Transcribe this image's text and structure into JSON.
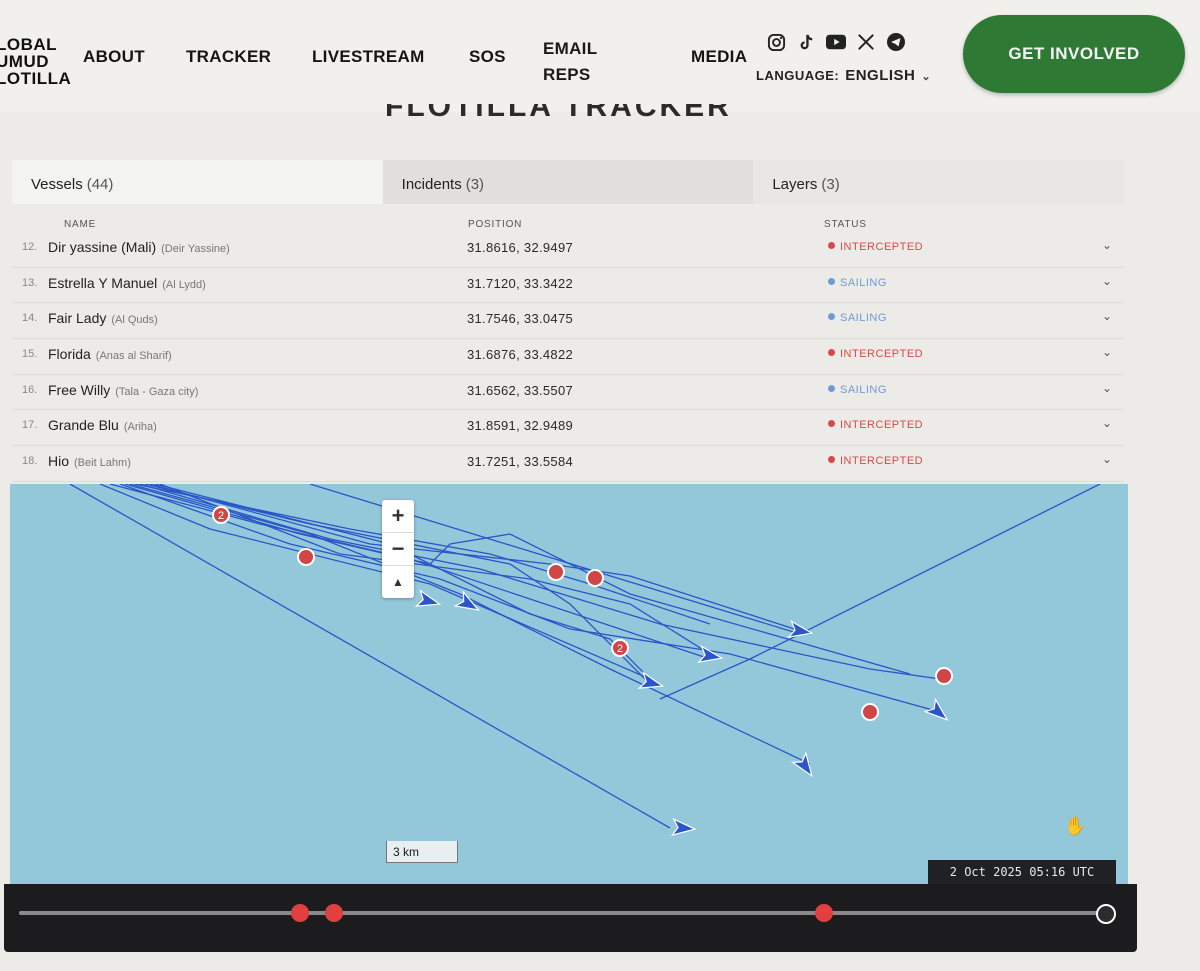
{
  "header": {
    "logo_lines": [
      "LOBAL",
      "UMUD",
      "LOTILLA"
    ],
    "nav": {
      "about": "ABOUT",
      "tracker": "TRACKER",
      "livestream": "LIVESTREAM",
      "sos": "SOS",
      "email_line1": "EMAIL",
      "email_line2": "REPS",
      "media": "MEDIA"
    },
    "social_icons": [
      "instagram-icon",
      "tiktok-icon",
      "youtube-icon",
      "x-icon",
      "telegram-icon"
    ],
    "language_label": "LANGUAGE:",
    "language_value": "ENGLISH",
    "cta_label": "GET INVOLVED",
    "page_heading": "FLOTILLA TRACKER"
  },
  "tabs": [
    {
      "label": "Vessels",
      "count": "(44)"
    },
    {
      "label": "Incidents",
      "count": "(3)"
    },
    {
      "label": "Layers",
      "count": "(3)"
    }
  ],
  "table": {
    "columns": {
      "name": "NAME",
      "position": "POSITION",
      "status": "STATUS"
    },
    "rows": [
      {
        "num": "12.",
        "name": "Dir yassine (Mali)",
        "sub": "(Deir Yassine)",
        "position": "31.8616, 32.9497",
        "status": "INTERCEPTED"
      },
      {
        "num": "13.",
        "name": "Estrella Y Manuel",
        "sub": "(Al Lydd)",
        "position": "31.7120, 33.3422",
        "status": "SAILING"
      },
      {
        "num": "14.",
        "name": "Fair Lady",
        "sub": "(Al Quds)",
        "position": "31.7546, 33.0475",
        "status": "SAILING"
      },
      {
        "num": "15.",
        "name": "Florida",
        "sub": "(Anas al Sharif)",
        "position": "31.6876, 33.4822",
        "status": "INTERCEPTED"
      },
      {
        "num": "16.",
        "name": "Free Willy",
        "sub": "(Tala - Gaza city)",
        "position": "31.6562, 33.5507",
        "status": "SAILING"
      },
      {
        "num": "17.",
        "name": "Grande Blu",
        "sub": "(Ariha)",
        "position": "31.8591, 32.9489",
        "status": "INTERCEPTED"
      },
      {
        "num": "18.",
        "name": "Hio",
        "sub": "(Beit Lahm)",
        "position": "31.7251, 33.5584",
        "status": "INTERCEPTED"
      }
    ]
  },
  "status_colors": {
    "INTERCEPTED": "#d94848",
    "SAILING": "#6f9ad6"
  },
  "map": {
    "zoom_in": "+",
    "zoom_out": "−",
    "compass": "▲",
    "cluster_labels": [
      "2",
      "2"
    ],
    "scale_label": "3 km",
    "timestamp": "2 Oct 2025 05:16 UTC",
    "route_color": "#2a56c8",
    "incident_color": "#d04545"
  },
  "timeline": {
    "track_color": "#8a8a8a",
    "marker_color": "#e04040"
  }
}
